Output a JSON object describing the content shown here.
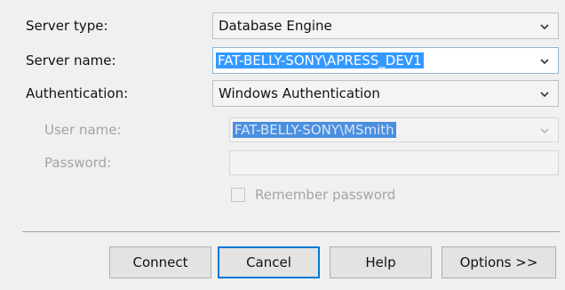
{
  "form": {
    "server_type": {
      "label": "Server type:",
      "value": "Database Engine"
    },
    "server_name": {
      "label": "Server name:",
      "value": "FAT-BELLY-SONY\\APRESS_DEV1"
    },
    "authentication": {
      "label": "Authentication:",
      "value": "Windows Authentication"
    },
    "user_name": {
      "label": "User name:",
      "value": "FAT-BELLY-SONY\\MSmith"
    },
    "password": {
      "label": "Password:",
      "value": ""
    },
    "remember_password": {
      "label": "Remember password",
      "checked": false
    }
  },
  "buttons": {
    "connect": "Connect",
    "cancel": "Cancel",
    "help": "Help",
    "options": "Options >>"
  },
  "colors": {
    "selection": "#3399ff",
    "default_button_border": "#0078d7",
    "disabled_text": "#a4a4a4"
  },
  "icons": {
    "dropdown": "chevron-down-icon"
  }
}
